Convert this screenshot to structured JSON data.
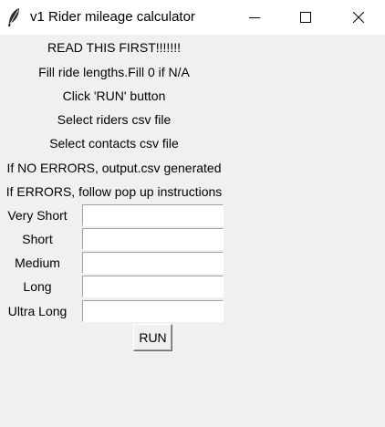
{
  "window": {
    "title": "v1 Rider mileage calculator",
    "icon": "feather-icon",
    "controls": [
      "minimize-icon",
      "maximize-icon",
      "close-icon"
    ]
  },
  "instructions": [
    "READ THIS FIRST!!!!!!!",
    "Fill ride lengths.Fill 0 if N/A",
    "Click 'RUN' button",
    "Select riders csv file",
    "Select contacts csv file",
    "If NO ERRORS, output.csv generated",
    "If ERRORS, follow pop up instructions"
  ],
  "fields": [
    {
      "label": "Very Short",
      "value": ""
    },
    {
      "label": "Short",
      "value": ""
    },
    {
      "label": "Medium",
      "value": ""
    },
    {
      "label": "Long",
      "value": ""
    },
    {
      "label": "Ultra Long",
      "value": ""
    }
  ],
  "run_button": {
    "label": "RUN"
  }
}
